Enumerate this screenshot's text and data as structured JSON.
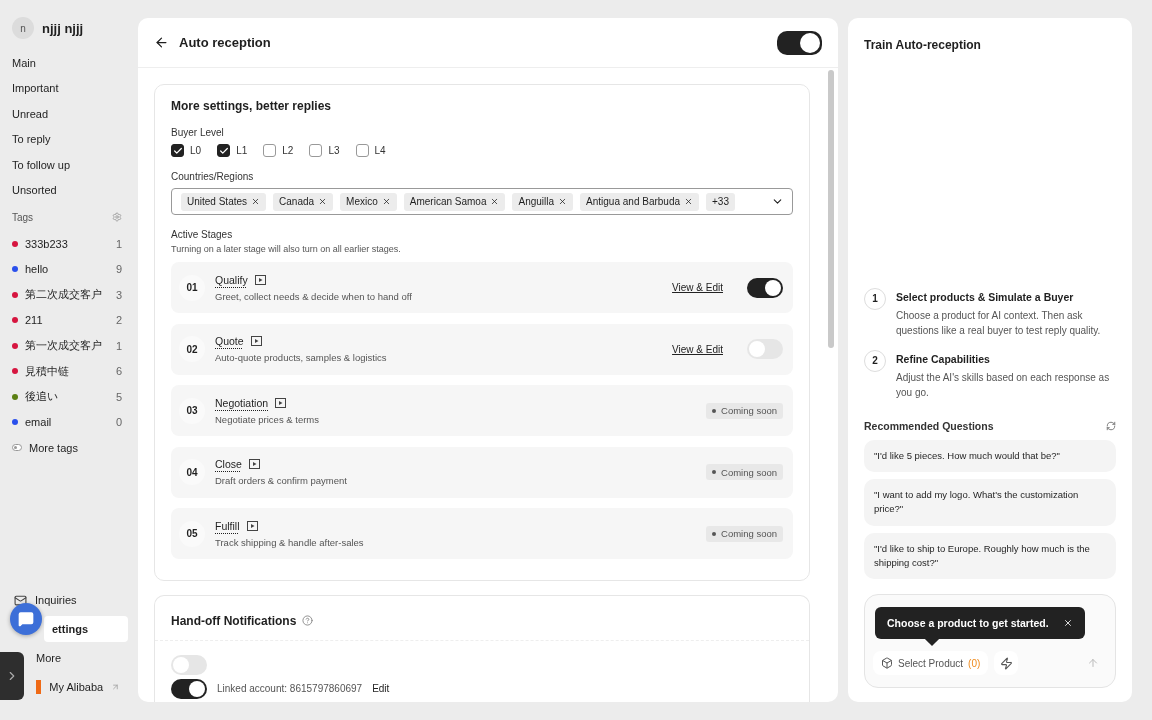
{
  "sidebar": {
    "user": {
      "initial": "n",
      "name": "njjj njjj"
    },
    "nav": [
      "Main",
      "Important",
      "Unread",
      "To reply",
      "To follow up",
      "Unsorted"
    ],
    "tags_title": "Tags",
    "tags": [
      {
        "label": "333b233",
        "count": "1",
        "color": "#d6153f"
      },
      {
        "label": "hello",
        "count": "9",
        "color": "#2a50ec"
      },
      {
        "label": "第二次成交客户",
        "count": "3",
        "color": "#d6153f"
      },
      {
        "label": "211",
        "count": "2",
        "color": "#d6153f"
      },
      {
        "label": "第一次成交客户",
        "count": "1",
        "color": "#d6153f"
      },
      {
        "label": "見積中链",
        "count": "6",
        "color": "#d6153f"
      },
      {
        "label": "後追い",
        "count": "5",
        "color": "#5b7f12"
      },
      {
        "label": "email",
        "count": "0",
        "color": "#2a50ec"
      }
    ],
    "more_tags": "More tags",
    "bottom": [
      {
        "label": "Inquiries",
        "kind": "mail",
        "selected": false
      },
      {
        "label": "ettings",
        "kind": "settings",
        "selected": true
      },
      {
        "label": "More",
        "kind": "more",
        "selected": false
      },
      {
        "label": "My Alibaba",
        "kind": "external",
        "selected": false
      }
    ]
  },
  "main": {
    "title": "Auto reception",
    "enabled": true,
    "settings_card": {
      "title": "More settings, better replies",
      "buyer_level_label": "Buyer Level",
      "levels": [
        {
          "label": "L0",
          "checked": true
        },
        {
          "label": "L1",
          "checked": true
        },
        {
          "label": "L2",
          "checked": false
        },
        {
          "label": "L3",
          "checked": false
        },
        {
          "label": "L4",
          "checked": false
        }
      ],
      "countries_label": "Countries/Regions",
      "countries": [
        "United States",
        "Canada",
        "Mexico",
        "American Samoa",
        "Anguilla",
        "Antigua and Barbuda"
      ],
      "more_count": "+33",
      "stages_label": "Active Stages",
      "stages_hint": "Turning on a later stage will also turn on all earlier stages.",
      "stages": [
        {
          "number": "01",
          "title": "Qualify",
          "description": "Greet, collect needs & decide when to hand off",
          "kind": "toggle",
          "link": "View & Edit",
          "on": true
        },
        {
          "number": "02",
          "title": "Quote",
          "description": "Auto-quote products, samples & logistics",
          "kind": "toggle",
          "link": "View & Edit",
          "on": false
        },
        {
          "number": "03",
          "title": "Negotiation",
          "description": "Negotiate prices & terms",
          "kind": "coming_soon",
          "badge": "Coming soon"
        },
        {
          "number": "04",
          "title": "Close",
          "description": "Draft orders & confirm payment",
          "kind": "coming_soon",
          "badge": "Coming soon"
        },
        {
          "number": "05",
          "title": "Fulfill",
          "description": "Track shipping & handle after-sales",
          "kind": "coming_soon",
          "badge": "Coming soon"
        }
      ]
    },
    "handoff": {
      "title": "Hand-off Notifications",
      "rows": [
        {
          "on": false
        },
        {
          "on": true,
          "text": "Linked account: 8615797860697",
          "action": "Edit"
        }
      ]
    }
  },
  "train": {
    "title": "Train Auto-reception",
    "steps": [
      {
        "number": "1",
        "title": "Select products & Simulate a Buyer",
        "description": "Choose a product for AI context. Then ask questions like a real buyer to test reply quality."
      },
      {
        "number": "2",
        "title": "Refine Capabilities",
        "description": "Adjust the AI's skills based on each response as you go."
      }
    ],
    "questions_title": "Recommended Questions",
    "questions": [
      "\"I'd like 5 pieces. How much would that be?\"",
      "\"I want to add my logo. What's the customization price?\"",
      "\"I'd like to ship to Europe. Roughly how much is the shipping cost?\""
    ],
    "tooltip": "Choose a product to get started.",
    "select_product": "Select Product",
    "product_count": "(0)"
  }
}
